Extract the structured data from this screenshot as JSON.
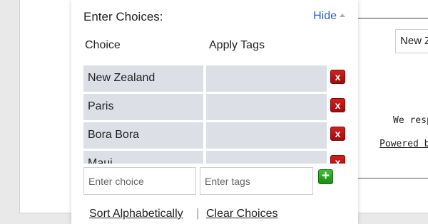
{
  "background": {
    "input_value": "New Z",
    "text_line1": "We resp",
    "text_line2": "Powered b"
  },
  "panel": {
    "title": "Enter Choices:",
    "hide_label": "Hide",
    "columns": {
      "choice": "Choice",
      "tags": "Apply Tags"
    },
    "rows": [
      {
        "choice": "New Zealand",
        "tags": ""
      },
      {
        "choice": "Paris",
        "tags": ""
      },
      {
        "choice": "Bora Bora",
        "tags": ""
      },
      {
        "choice": "Maui",
        "tags": ""
      }
    ],
    "delete_icon": "x",
    "add_icon": "+",
    "new_choice_placeholder": "Enter choice",
    "new_tags_placeholder": "Enter tags",
    "sort_label": "Sort Alphabetically",
    "separator": "|",
    "clear_label": "Clear Choices"
  },
  "colors": {
    "link": "#2b5fbf",
    "cell_bg": "#dcdfe6",
    "delete": "#c01515",
    "add": "#2ea726"
  }
}
